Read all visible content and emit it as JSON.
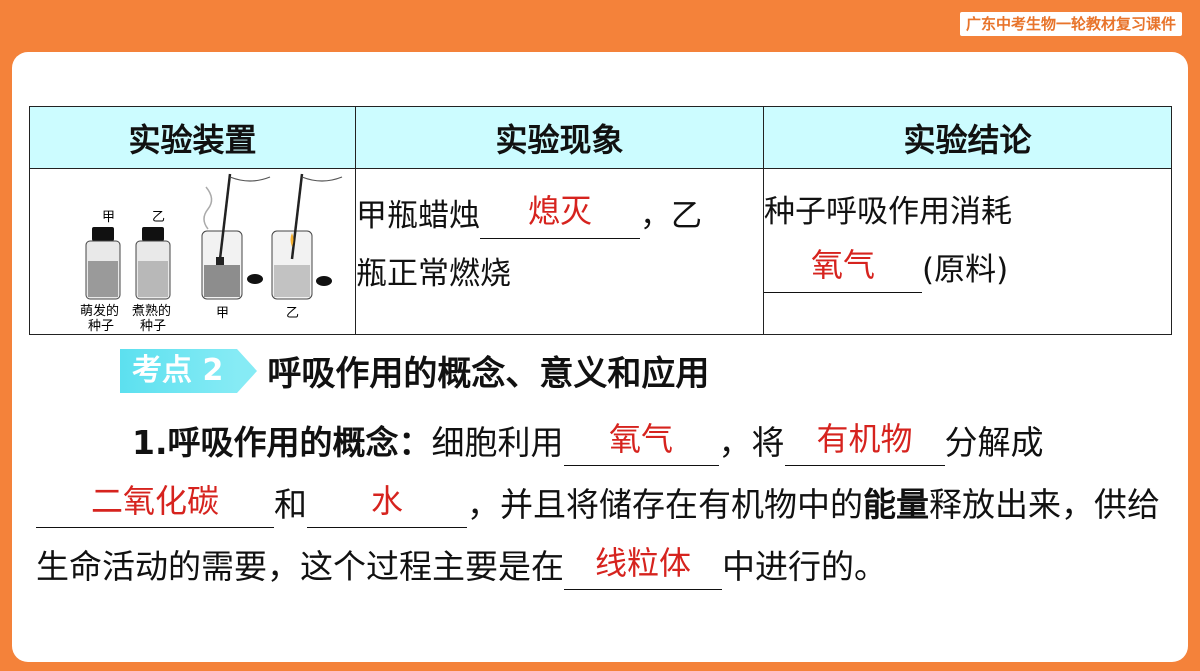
{
  "header": {
    "badge": "广东中考生物一轮教材复习课件"
  },
  "table": {
    "headers": [
      "实验装置",
      "实验现象",
      "实验结论"
    ],
    "apparatus": {
      "jar_labels": [
        "甲",
        "乙"
      ],
      "caption_1a": "萌发的",
      "caption_1b": "种子",
      "caption_2a": "煮熟的",
      "caption_2b": "种子",
      "bottle_labels": [
        "甲",
        "乙"
      ]
    },
    "phenomenon": {
      "pre": "甲瓶蜡烛",
      "answer": "熄灭",
      "post1": "，乙",
      "post2": "瓶正常燃烧"
    },
    "conclusion": {
      "pre": "种子呼吸作用消耗",
      "answer": "氧气",
      "post": "(原料)"
    }
  },
  "section": {
    "tag": "考点 2",
    "title": "呼吸作用的概念、意义和应用"
  },
  "paragraph": {
    "lead": "1.呼吸作用的概念：",
    "t1": "细胞利用",
    "a1": "氧气",
    "t2": "，将",
    "a2": "有机物",
    "t3": "分解成",
    "a3": "二氧化碳",
    "t4": "和",
    "a4": "水",
    "t5": "，并且将储存在有机物中的",
    "bold1": "能量",
    "t6": "释放出来，供给生命活动的需要，这个过程主要是在",
    "a5": "线粒体",
    "t7": "中进行的。"
  },
  "colors": {
    "background": "#f4823a",
    "header_fill": "#ccfcff",
    "answer": "#d6231e",
    "tag": "#5ce0ef"
  }
}
